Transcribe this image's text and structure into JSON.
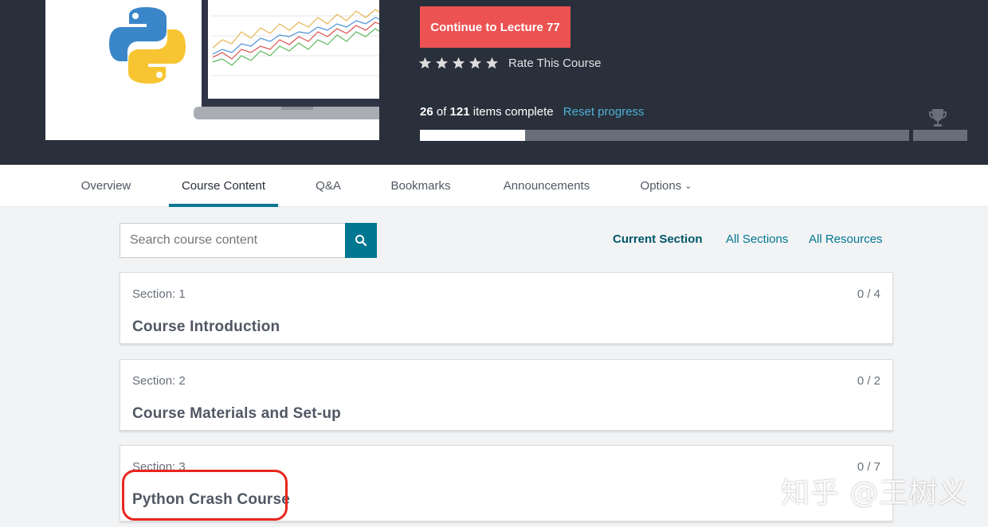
{
  "header": {
    "cta_label": "Continue to Lecture 77",
    "rating_label": "Rate This Course",
    "stars": 5,
    "progress": {
      "completed": "26",
      "of_word": "of",
      "total": "121",
      "suffix": "items complete",
      "reset_label": "Reset progress",
      "fraction": 0.215
    },
    "colors": {
      "background": "#29303b",
      "cta": "#ec5252",
      "link": "#4fb0d6"
    }
  },
  "tabs": [
    {
      "label": "Overview"
    },
    {
      "label": "Course Content",
      "active": true
    },
    {
      "label": "Q&A"
    },
    {
      "label": "Bookmarks"
    },
    {
      "label": "Announcements"
    },
    {
      "label": "Options"
    }
  ],
  "search": {
    "placeholder": "Search course content",
    "icon": "search-icon"
  },
  "filters": [
    {
      "label": "Current Section",
      "active": true
    },
    {
      "label": "All Sections"
    },
    {
      "label": "All Resources"
    }
  ],
  "sections": [
    {
      "label": "Section: 1",
      "title": "Course Introduction",
      "count": "0 / 4"
    },
    {
      "label": "Section: 2",
      "title": "Course Materials and Set-up",
      "count": "0 / 2"
    },
    {
      "label": "Section: 3",
      "title": "Python Crash Course",
      "count": "0 / 7"
    }
  ],
  "watermark": "知乎 @王树义",
  "accent_color": "#007791"
}
